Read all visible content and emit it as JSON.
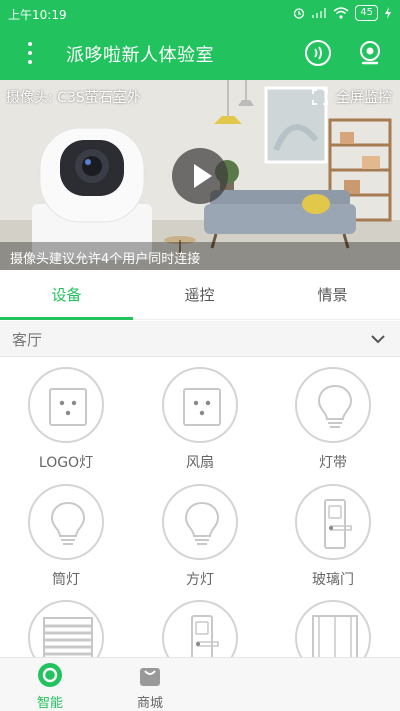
{
  "status_bar": {
    "time": "上午10:19",
    "battery": "45"
  },
  "app_bar": {
    "title": "派哆啦新人体验室"
  },
  "camera": {
    "label": "摄像头: C3S萤石室外",
    "fullscreen_label": "全屏监控",
    "hint": "摄像头建议允许4个用户同时连接"
  },
  "tabs": [
    {
      "label": "设备",
      "active": true
    },
    {
      "label": "遥控",
      "active": false
    },
    {
      "label": "情景",
      "active": false
    }
  ],
  "room": {
    "name": "客厅"
  },
  "devices": [
    {
      "label": "LOGO灯",
      "icon": "socket-icon"
    },
    {
      "label": "风扇",
      "icon": "socket-icon"
    },
    {
      "label": "灯带",
      "icon": "bulb-icon"
    },
    {
      "label": "筒灯",
      "icon": "bulb-icon"
    },
    {
      "label": "方灯",
      "icon": "bulb-icon"
    },
    {
      "label": "玻璃门",
      "icon": "door-lock-icon"
    },
    {
      "label": "",
      "icon": "blinds-icon"
    },
    {
      "label": "",
      "icon": "door-lock-icon"
    },
    {
      "label": "",
      "icon": "window-icon"
    }
  ],
  "bottom_nav": [
    {
      "label": "智能",
      "icon": "smart-home-icon",
      "active": true
    },
    {
      "label": "商城",
      "icon": "shopping-bag-icon",
      "active": false
    }
  ],
  "colors": {
    "accent": "#22c35e",
    "icon_gray": "#c8c8c8"
  }
}
